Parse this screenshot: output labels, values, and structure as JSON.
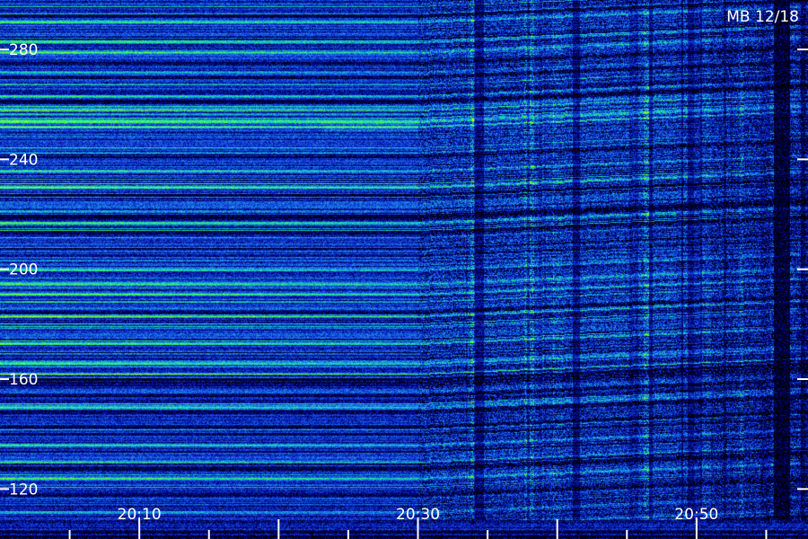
{
  "chart_data": {
    "type": "heatmap",
    "title": "MB 12/18",
    "xlabel": "",
    "ylabel": "",
    "x_ticks": [
      "20:10",
      "20:30",
      "20:50"
    ],
    "x_tick_minutes": [
      10,
      30,
      50
    ],
    "xlim_minutes": [
      0,
      58
    ],
    "y_ticks": [
      280,
      240,
      200,
      160,
      120
    ],
    "ylim": [
      109,
      298
    ],
    "colormap": [
      "#000000",
      "#00006e",
      "#0a2ccc",
      "#1d63e6",
      "#14b4d2",
      "#22e6a0",
      "#5aff2a",
      "#c8ff00"
    ],
    "grid": false,
    "bright_bands_left": [
      124,
      130,
      136,
      150,
      162,
      166,
      173,
      183,
      191,
      195,
      200,
      217,
      221,
      230,
      236,
      252,
      254,
      258,
      263,
      272,
      279,
      283,
      290
    ],
    "pattern_break_minute": 30,
    "noise_region_from_minute": 51
  }
}
